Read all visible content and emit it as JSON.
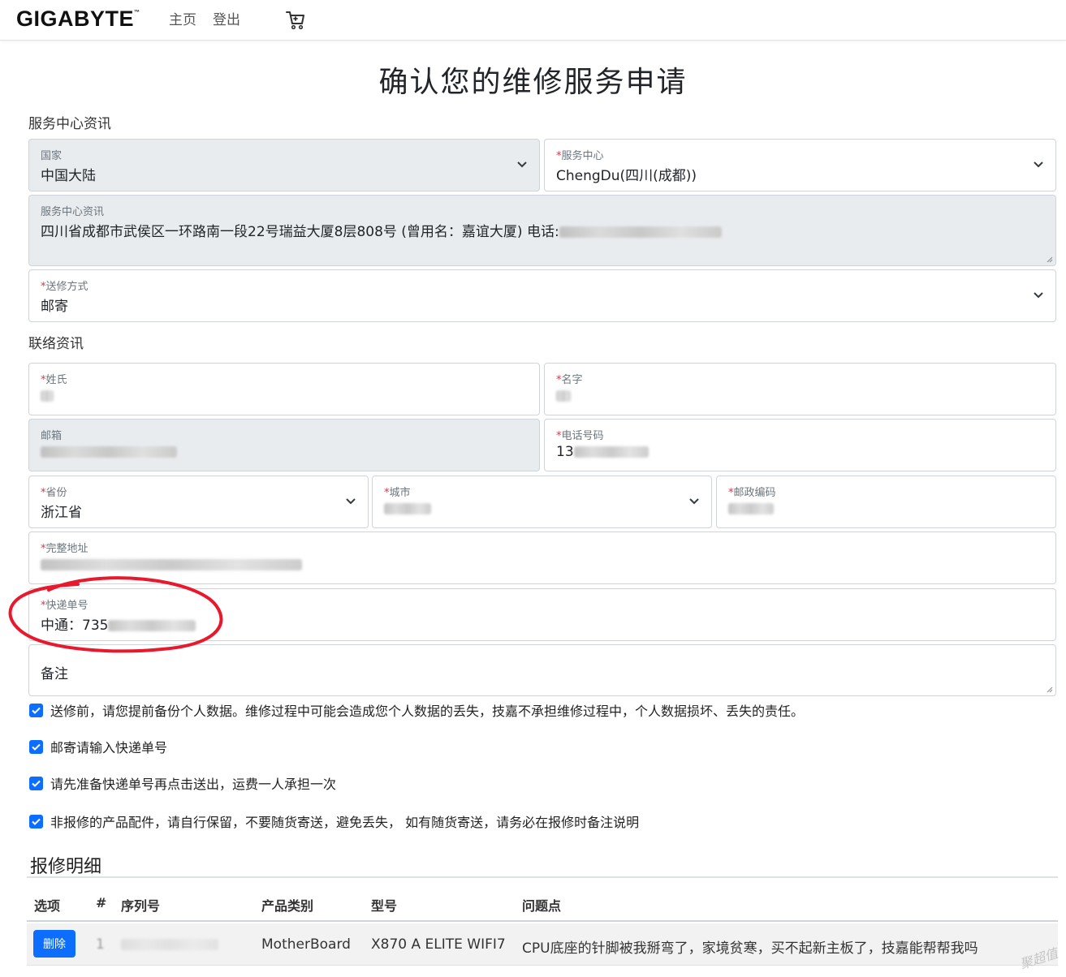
{
  "nav": {
    "logo": "GIGABYTE",
    "logo_mark": "™",
    "links": [
      "主页",
      "登出"
    ],
    "cart_icon": "cart-icon"
  },
  "page_title": "确认您的维修服务申请",
  "sections": {
    "service_center": "服务中心资讯",
    "contact": "联络资讯"
  },
  "fields": {
    "country": {
      "label": "国家",
      "value": "中国大陆"
    },
    "service_center": {
      "label": "服务中心",
      "value": "ChengDu(四川(成都))"
    },
    "center_info": {
      "label": "服务中心资讯",
      "value": "四川省成都市武侯区一环路南一段22号瑞益大厦8层808号 (曾用名：嘉谊大厦) 电话:"
    },
    "shipping_method": {
      "label": "送修方式",
      "value": "邮寄"
    },
    "surname": {
      "label": "姓氏",
      "value": ""
    },
    "given_name": {
      "label": "名字",
      "value": ""
    },
    "email": {
      "label": "邮箱",
      "value": ""
    },
    "phone": {
      "label": "电话号码",
      "value": "13"
    },
    "province": {
      "label": "省份",
      "value": "浙江省"
    },
    "city": {
      "label": "城市",
      "value": ""
    },
    "postal_code": {
      "label": "邮政编码",
      "value": ""
    },
    "full_address": {
      "label": "完整地址",
      "value": ""
    },
    "tracking_number": {
      "label": "快递单号",
      "value": "中通：735"
    },
    "remarks": {
      "placeholder": "备注"
    }
  },
  "required_mark": "*",
  "checks": [
    "送修前，请您提前备份个人数据。维修过程中可能会造成您个人数据的丢失，技嘉不承担维修过程中，个人数据损坏、丢失的责任。",
    "邮寄请输入快递单号",
    "请先准备快递单号再点击送出，运费一人承担一次",
    "非报修的产品配件，请自行保留，不要随货寄送，避免丢失， 如有随货寄送，请务必在报修时备注说明"
  ],
  "repair_detail": {
    "title": "报修明细",
    "headers": [
      "选项",
      "#",
      "序列号",
      "产品类别",
      "型号",
      "问题点"
    ],
    "rows": [
      {
        "action": "删除",
        "index": "1",
        "serial": "",
        "category": "MotherBoard",
        "model": "X870 A ELITE WIFI7",
        "issue": "CPU底座的针脚被我掰弯了，家境贫寒，买不起新主板了，技嘉能帮帮我吗"
      }
    ]
  },
  "watermark": "聚超值",
  "colors": {
    "primary": "#0d6efd",
    "required": "#dc3545",
    "annotation": "#e8192c",
    "disabled_bg": "#e9ecef"
  }
}
